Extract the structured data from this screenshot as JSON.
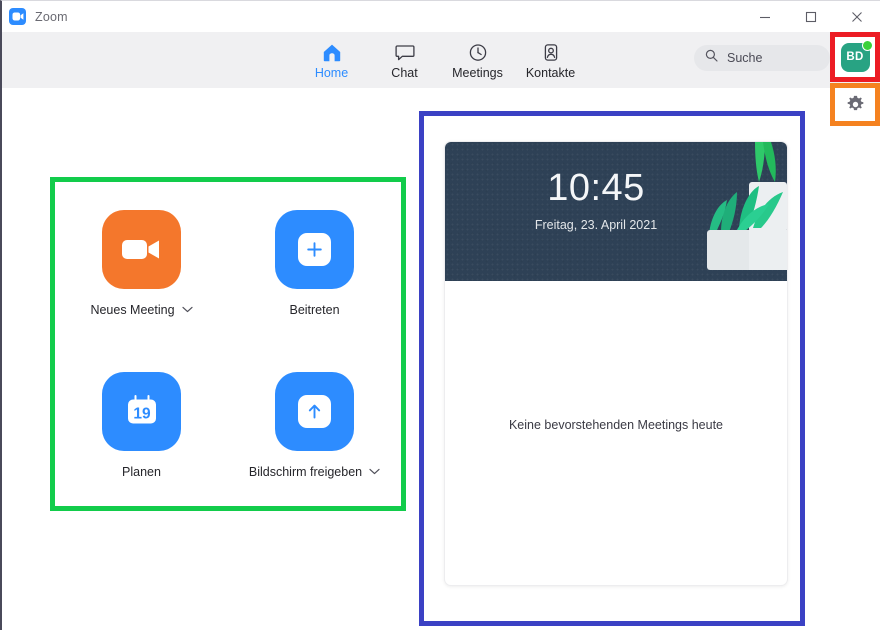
{
  "window": {
    "app_title": "Zoom",
    "logo_icon": "zoom-camera-logo",
    "controls": {
      "minimize": "minimize-icon",
      "maximize": "maximize-icon",
      "close": "close-icon"
    }
  },
  "nav": {
    "tabs": [
      {
        "label": "Home",
        "icon": "home-icon",
        "active": true
      },
      {
        "label": "Chat",
        "icon": "chat-bubble-icon",
        "active": false
      },
      {
        "label": "Meetings",
        "icon": "clock-icon",
        "active": false
      },
      {
        "label": "Kontakte",
        "icon": "contact-person-icon",
        "active": false
      }
    ],
    "search": {
      "placeholder": "Suche",
      "value": "Suche",
      "icon": "search-icon"
    },
    "avatar": {
      "initials": "BD",
      "status": "available",
      "icon": "avatar",
      "color": "#28a383",
      "status_color": "#3ad13a"
    },
    "settings": {
      "icon": "gear-icon",
      "label": "Einstellungen"
    }
  },
  "actions": [
    {
      "label": "Neues Meeting",
      "icon": "video-camera-icon",
      "tile_color": "#f4772c",
      "has_dropdown": true
    },
    {
      "label": "Beitreten",
      "icon": "plus-icon",
      "tile_color": "#2d8cff",
      "has_dropdown": false
    },
    {
      "label": "Planen",
      "icon": "calendar-icon",
      "calendar_day": "19",
      "tile_color": "#2d8cff",
      "has_dropdown": false
    },
    {
      "label": "Bildschirm freigeben",
      "icon": "share-screen-arrow-icon",
      "tile_color": "#2d8cff",
      "has_dropdown": true
    }
  ],
  "meeting_panel": {
    "clock": {
      "time": "10:45",
      "date": "Freitag, 23. April 2021",
      "background_color": "#2e4156",
      "illustration": "potted-plant-illustration"
    },
    "empty_state": "Keine bevorstehenden Meetings heute"
  },
  "highlights": {
    "avatar_box_color": "#ec1c24",
    "settings_box_color": "#f58220",
    "actions_box_color": "#12cc4b",
    "panel_box_color": "#3b41c4"
  }
}
